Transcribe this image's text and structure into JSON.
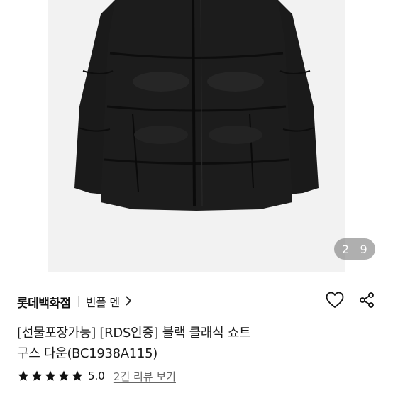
{
  "gallery": {
    "current": "2",
    "total": "9"
  },
  "product": {
    "brand": "롯데백화점",
    "shop": "빈폴 멘",
    "title_line1": "[선물포장가능] [RDS인증] 블랙 클래식 쇼트",
    "title_line2": "구스 다운(BC1938A115)"
  },
  "rating": {
    "stars": 5,
    "value": "5.0",
    "review_link": "2건 리뷰 보기"
  },
  "icons": {
    "chevron": "chevron-right-icon",
    "heart": "heart-outline-icon",
    "share": "share-icon",
    "star": "star-filled-icon"
  },
  "colors": {
    "star": "#111111",
    "image_bg": "#f2f2f2",
    "jacket": "#1b1b1b"
  }
}
